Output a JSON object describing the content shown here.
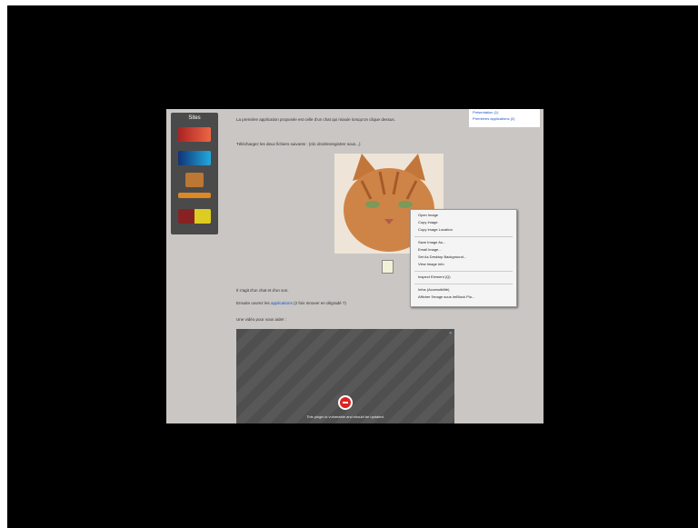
{
  "sidebar": {
    "title": "Sites"
  },
  "toc": {
    "items": [
      "Présentation (1)",
      "Premières applications (2)"
    ]
  },
  "content": {
    "para1": "La première application proposée est celle d'un chat qui miaule lorsqu'on clique dessus.",
    "para2": "Téléchargez les deux fichiers suivants : (clic droit/enregistrer sous...)",
    "para3": "Il s'agit d'un chat et d'un son.",
    "para4_before": "Ensuite ouvrez les",
    "para4_link": "applications",
    "para4_after": "(2 fois Innover en dégradé ?)",
    "para5": "Une vidéo pour vous aider :"
  },
  "context_menu": {
    "items": [
      "Open Image",
      "Copy Image",
      "Copy Image Location",
      "Save Image As...",
      "Email Image...",
      "Set As Desktop Background...",
      "View Image Info",
      "Inspect Element (Q)",
      "Infos (Accessibilité)",
      "Afficher l'image sous ImBlock Plu..."
    ]
  },
  "video": {
    "blocked_message": "This plugin is vulnerable and should be updated."
  }
}
